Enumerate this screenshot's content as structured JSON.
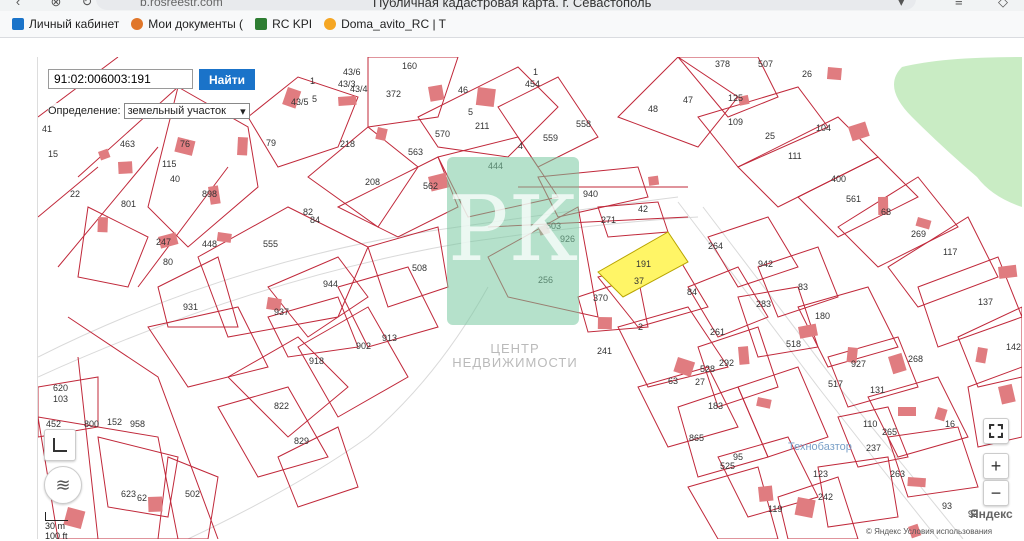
{
  "browser": {
    "url": "b.rosreestr.com",
    "page_title": "Публичная кадастровая карта. г. Севастополь",
    "bookmarks": [
      {
        "label": "Личный кабинет",
        "color": "#1a73c9"
      },
      {
        "label": "Мои документы (",
        "color": "#e0762a"
      },
      {
        "label": "RC KPI",
        "color": "#2e7d32"
      },
      {
        "label": "Doma_avito_RC | T",
        "color": "#f5a623"
      }
    ]
  },
  "search": {
    "value": "91:02:006003:191",
    "button": "Найти"
  },
  "definition": {
    "label": "Определение:",
    "selected": "земельный участок"
  },
  "watermark": {
    "letters": "РК",
    "line1": "ЦЕНТР",
    "line2": "НЕДВИЖИМОСТИ"
  },
  "map": {
    "street_label": "Технобазтор",
    "selected_parcel": "191",
    "colors": {
      "parcel_border": "#c0283a",
      "building": "#e07c80",
      "selected_fill": "#fff566",
      "green": "#c9ecc4"
    },
    "parcel_labels": [
      "1",
      "372",
      "454",
      "5",
      "211",
      "4",
      "559",
      "558",
      "563",
      "570",
      "218",
      "208",
      "562",
      "444",
      "940",
      "42",
      "271",
      "503",
      "926",
      "191",
      "37",
      "256",
      "370",
      "264",
      "942",
      "378",
      "507",
      "26",
      "47",
      "48",
      "125",
      "109",
      "25",
      "104",
      "111",
      "400",
      "561",
      "68",
      "269",
      "117",
      "137",
      "142",
      "15",
      "463",
      "115",
      "76",
      "22",
      "40",
      "898",
      "801",
      "448",
      "247",
      "80",
      "79",
      "82",
      "84",
      "555",
      "508",
      "944",
      "931",
      "937",
      "913",
      "918",
      "902",
      "822",
      "829",
      "620",
      "103",
      "452",
      "800",
      "152",
      "958",
      "623",
      "62",
      "502",
      "27",
      "84",
      "2",
      "241",
      "261",
      "292",
      "528",
      "63",
      "183",
      "865",
      "525",
      "95",
      "119",
      "123",
      "74",
      "242",
      "283",
      "83",
      "180",
      "518",
      "517",
      "927",
      "131",
      "268",
      "110",
      "265",
      "237",
      "263",
      "16",
      "93",
      "92",
      "1",
      "5",
      "43/5",
      "43/3",
      "43/4",
      "43/6",
      "160",
      "46",
      "41"
    ],
    "scale_metric": "30 m",
    "scale_imperial": "100 ft",
    "copyright": "© Яндекс   Условия использования",
    "yandex_logo": "Яндекс"
  },
  "controls": {
    "layers": "layers-icon",
    "ruler": "ruler-icon",
    "fullscreen": "fullscreen-icon",
    "zoom_in": "+",
    "zoom_out": "−"
  }
}
